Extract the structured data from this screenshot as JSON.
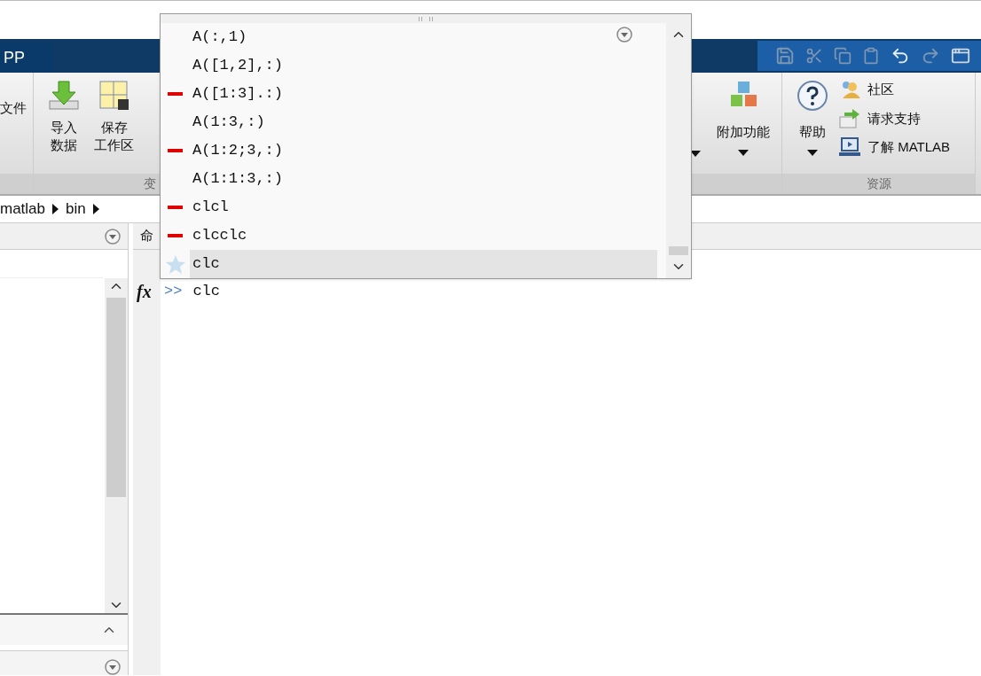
{
  "tab": {
    "label": "PP"
  },
  "ribbon": {
    "file_label": "文件",
    "buttons": [
      {
        "lines": [
          "导入",
          "数据"
        ],
        "kind": "import"
      },
      {
        "lines": [
          "保存",
          "工作区"
        ],
        "kind": "save"
      }
    ],
    "group_labels": [
      "变",
      "资源"
    ],
    "addons": {
      "label": "附加功能"
    },
    "help": {
      "label": "帮助"
    },
    "links": [
      {
        "label": "社区",
        "kind": "community"
      },
      {
        "label": "请求支持",
        "kind": "support"
      },
      {
        "label": "了解 MATLAB",
        "kind": "learn"
      }
    ]
  },
  "address": [
    "matlab",
    "bin"
  ],
  "command_window": {
    "header": "命",
    "fx_label": "fx",
    "prompt": ">>",
    "command": "clc"
  },
  "popup": {
    "items": [
      {
        "text": "A(:,1)",
        "kind": "plain",
        "selected": false
      },
      {
        "text": "A([1,2],:)",
        "kind": "plain",
        "selected": false
      },
      {
        "text": "A([1:3].:)",
        "kind": "error",
        "selected": false
      },
      {
        "text": "A(1:3,:)",
        "kind": "plain",
        "selected": false
      },
      {
        "text": "A(1:2;3,:)",
        "kind": "error",
        "selected": false
      },
      {
        "text": "A(1:1:3,:)",
        "kind": "plain",
        "selected": false
      },
      {
        "text": "clcl",
        "kind": "error",
        "selected": false
      },
      {
        "text": "clcclc",
        "kind": "error",
        "selected": false
      },
      {
        "text": "clc",
        "kind": "star",
        "selected": true
      }
    ]
  }
}
